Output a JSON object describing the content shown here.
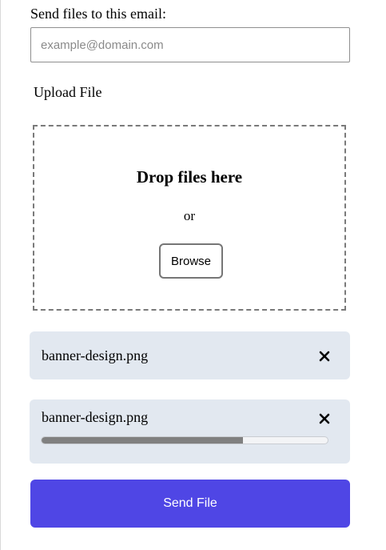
{
  "form": {
    "email_label": "Send files to this email:",
    "email_placeholder": "example@domain.com",
    "email_value": "",
    "upload_label": "Upload File"
  },
  "dropzone": {
    "title": "Drop files here",
    "or_text": "or",
    "browse_label": "Browse"
  },
  "files": [
    {
      "name": "banner-design.png",
      "remove_icon": "close-icon",
      "progress": null
    },
    {
      "name": "banner-design.png",
      "remove_icon": "close-icon",
      "progress": 0.705
    }
  ],
  "send_button_label": "Send File",
  "colors": {
    "accent": "#4f46e5",
    "file_card_bg": "#e2e8f0",
    "progress_fill": "#808080"
  }
}
